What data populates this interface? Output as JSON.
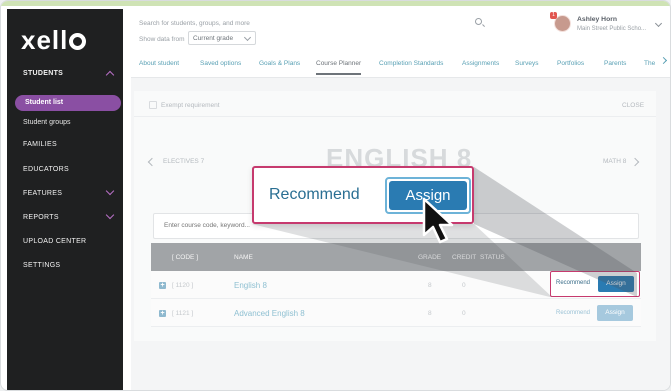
{
  "app": {
    "logo": "xello"
  },
  "sidebar": {
    "sections": [
      {
        "label": "STUDENTS"
      },
      {
        "label": "FAMILIES"
      },
      {
        "label": "EDUCATORS"
      },
      {
        "label": "FEATURES"
      },
      {
        "label": "REPORTS"
      },
      {
        "label": "UPLOAD CENTER"
      },
      {
        "label": "SETTINGS"
      }
    ],
    "subitems": [
      {
        "label": "Student list",
        "active": true
      },
      {
        "label": "Student groups",
        "active": false
      }
    ]
  },
  "header": {
    "search_placeholder": "Search for students, groups, and more",
    "show_data_label": "Show data from",
    "grade_value": "Current grade",
    "user": {
      "name": "Ashley Horn",
      "school": "Main Street Public Scho...",
      "badge": "1"
    }
  },
  "tabs": [
    {
      "label": "About student"
    },
    {
      "label": "Saved options"
    },
    {
      "label": "Goals & Plans"
    },
    {
      "label": "Course Planner",
      "active": true
    },
    {
      "label": "Completion Standards"
    },
    {
      "label": "Assignments"
    },
    {
      "label": "Surveys"
    },
    {
      "label": "Portfolios"
    },
    {
      "label": "Parents"
    },
    {
      "label": "The"
    }
  ],
  "panel": {
    "exempt_label": "Exempt requirement",
    "close_label": "CLOSE",
    "prev_label": "ELECTIVES 7",
    "title": "ENGLISH 8",
    "next_label": "MATH 8",
    "search_placeholder": "Enter course code, keyword..."
  },
  "table": {
    "headers": {
      "code": "[ CODE ]",
      "name": "NAME",
      "grade": "GRADE",
      "credit": "CREDIT",
      "status": "STATUS"
    },
    "rows": [
      {
        "code": "[ 1120 ]",
        "name": "English 8",
        "grade": "8",
        "credit": "0",
        "recommend": "Recommend",
        "assign": "Assign"
      },
      {
        "code": "[ 1121 ]",
        "name": "Advanced English 8",
        "grade": "8",
        "credit": "0",
        "recommend": "Recommend",
        "assign": "Assign"
      }
    ]
  },
  "callout": {
    "recommend": "Recommend",
    "assign": "Assign"
  },
  "colors": {
    "accent": "#8a4fa3",
    "assign": "#2a7bb2",
    "highlight": "#c63a6e",
    "link": "#59a0b4"
  }
}
